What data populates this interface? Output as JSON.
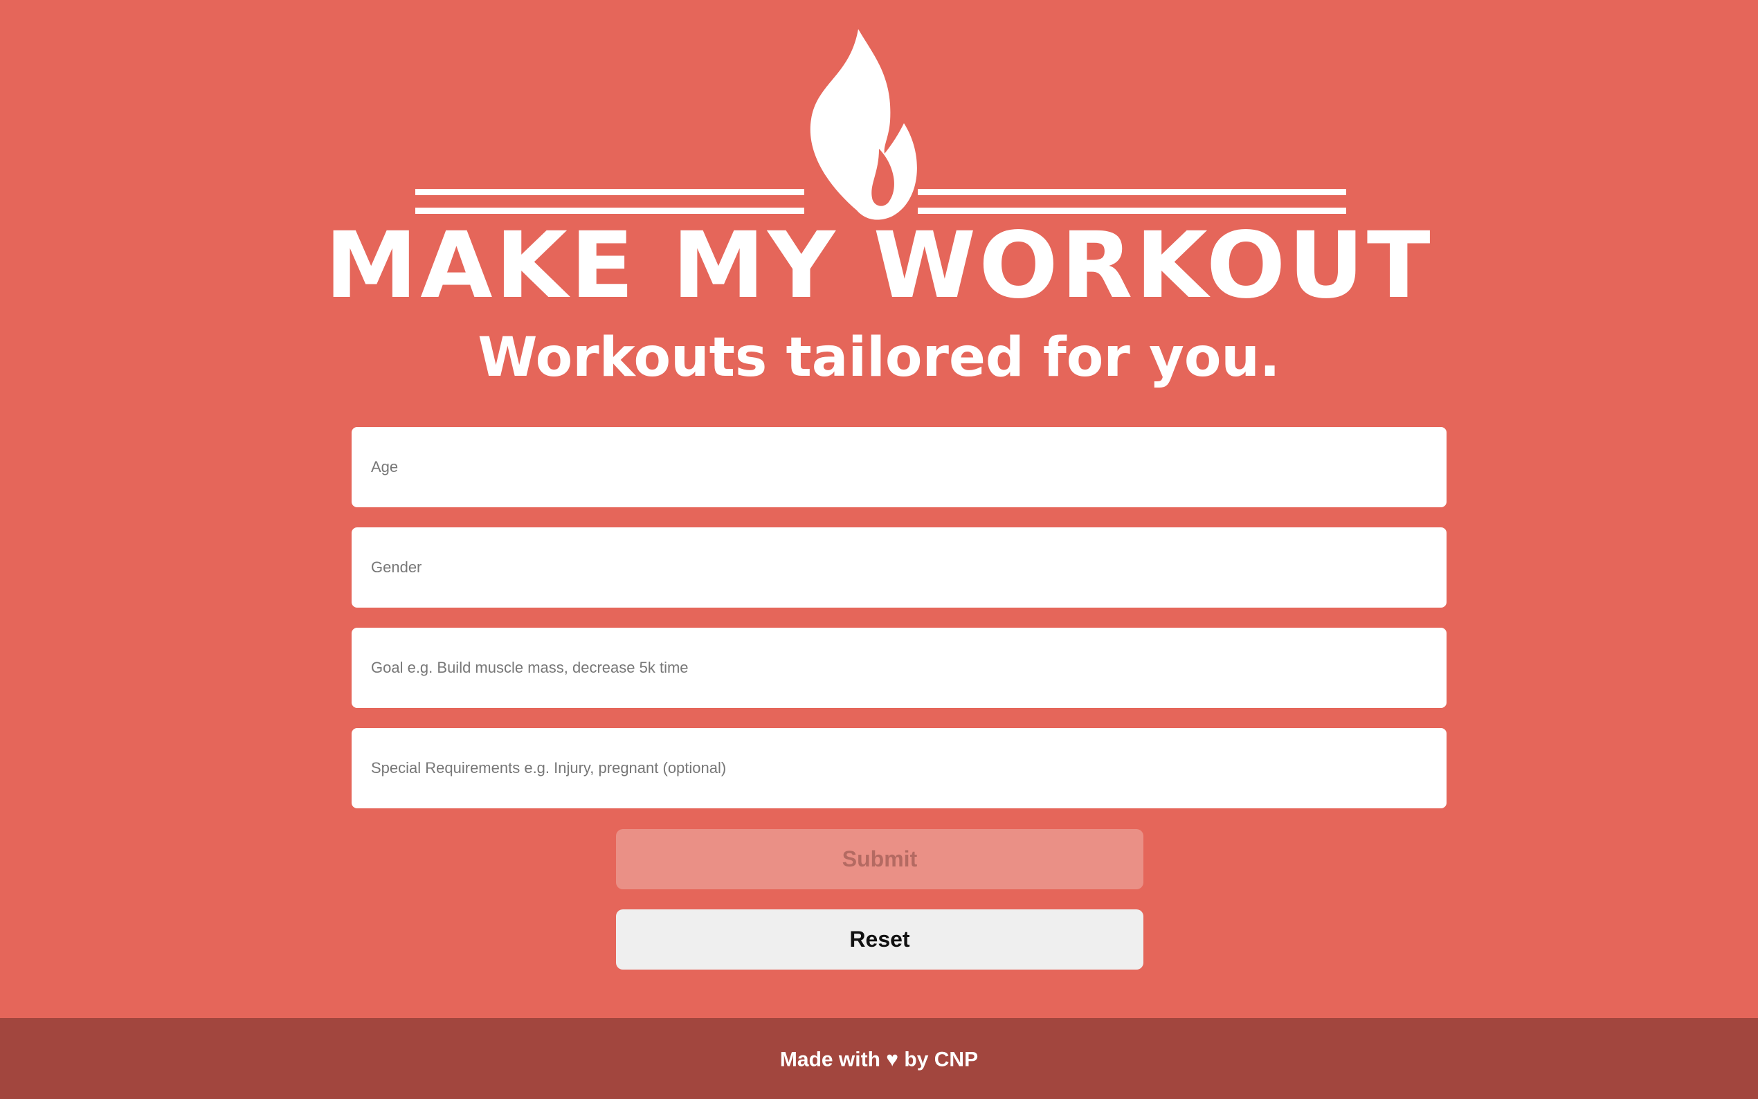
{
  "header": {
    "title": "MAKE MY WORKOUT",
    "tagline": "Workouts tailored for you.",
    "logo_icon": "flame-icon"
  },
  "form": {
    "age": {
      "placeholder": "Age",
      "value": ""
    },
    "gender": {
      "placeholder": "Gender",
      "value": ""
    },
    "goal": {
      "placeholder": "Goal e.g. Build muscle mass, decrease 5k time",
      "value": ""
    },
    "special": {
      "placeholder": "Special Requirements e.g. Injury, pregnant (optional)",
      "value": ""
    },
    "submit_label": "Submit",
    "reset_label": "Reset"
  },
  "footer": {
    "text_before": "Made with",
    "heart": "♥",
    "text_after": "by CNP"
  },
  "colors": {
    "background": "#E5665A",
    "footer_background": "#A2463E",
    "submit_disabled": "#EA9086",
    "reset_background": "#EFEFEF"
  }
}
